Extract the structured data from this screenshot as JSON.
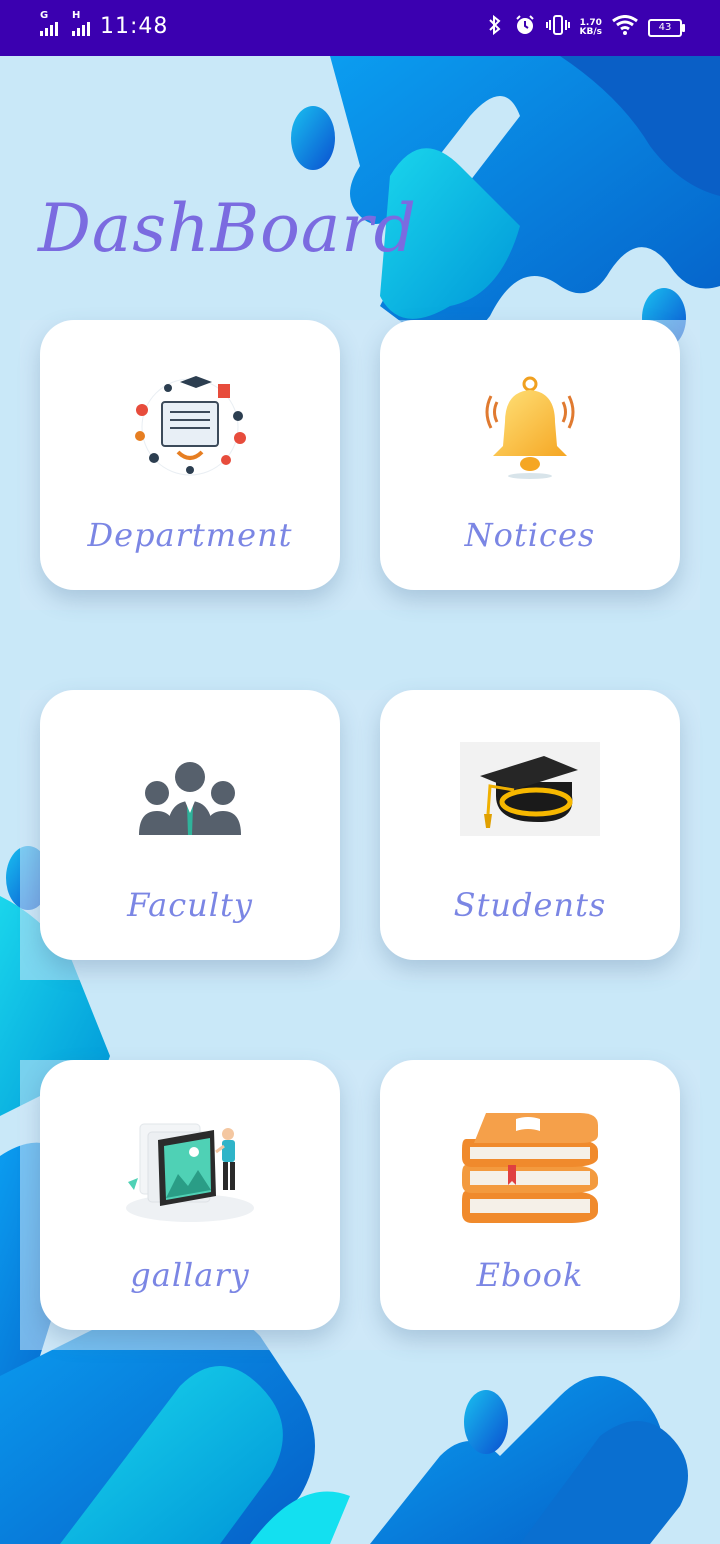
{
  "status": {
    "time": "11:48",
    "net_speed_value": "1.70",
    "net_speed_unit": "KB/s",
    "battery": "43",
    "sim1_type": "G",
    "sim2_type": "H"
  },
  "title": "DashBoard",
  "cards": [
    {
      "label": "Department",
      "icon": "department-icon"
    },
    {
      "label": "Notices",
      "icon": "bell-icon"
    },
    {
      "label": "Faculty",
      "icon": "people-icon"
    },
    {
      "label": "Students",
      "icon": "graduation-cap-icon"
    },
    {
      "label": "gallary",
      "icon": "gallery-icon"
    },
    {
      "label": "Ebook",
      "icon": "books-icon"
    }
  ],
  "colors": {
    "status_bar": "#3b00b0",
    "title": "#7b6be0",
    "label": "#7b86e4",
    "background": "#cfeaf8",
    "blob_dark": "#0a7fd9",
    "blob_cyan": "#00c6e0"
  }
}
